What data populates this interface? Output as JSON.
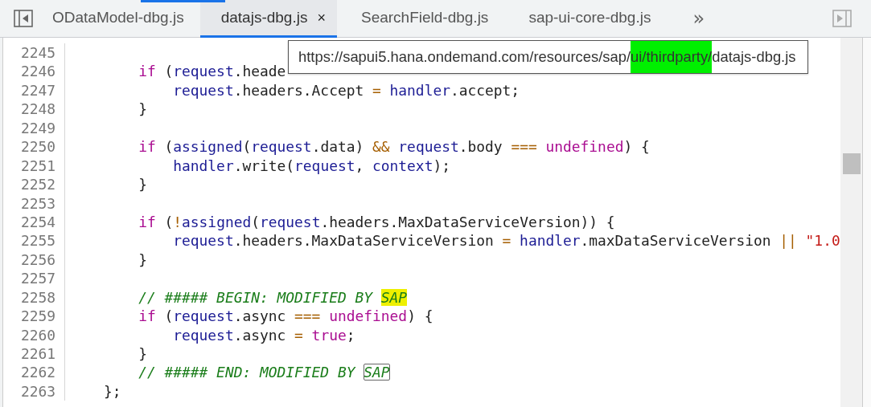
{
  "tabs": [
    {
      "label": "ODataModel-dbg.js",
      "selected": false
    },
    {
      "label": "datajs-dbg.js",
      "selected": true,
      "close": "×"
    },
    {
      "label": "SearchField-dbg.js",
      "selected": false
    },
    {
      "label": "sap-ui-core-dbg.js",
      "selected": false
    }
  ],
  "overflow": "»",
  "tooltip": {
    "parts": [
      {
        "text": "https://sapui5.hana.ondemand.com/resources/sap/",
        "highlighted": false
      },
      {
        "text": "ui/thirdparty/",
        "highlighted": true
      },
      {
        "text": "datajs-dbg.js",
        "highlighted": false
      }
    ]
  },
  "lines": [
    {
      "number": "2245"
    },
    {
      "number": "2246",
      "tokens": [
        {
          "kind": "keyword",
          "text": "        if"
        },
        {
          "kind": "plain",
          "text": " ("
        },
        {
          "kind": "variable",
          "text": "request"
        },
        {
          "kind": "plain",
          "text": ".heade"
        }
      ]
    },
    {
      "number": "2247",
      "tokens": [
        {
          "kind": "variable",
          "text": "            request"
        },
        {
          "kind": "plain",
          "text": ".headers.Accept "
        },
        {
          "kind": "operator",
          "text": "="
        },
        {
          "kind": "variable",
          "text": " handler"
        },
        {
          "kind": "plain",
          "text": ".accept;"
        }
      ]
    },
    {
      "number": "2248",
      "tokens": [
        {
          "kind": "plain",
          "text": "        }"
        }
      ]
    },
    {
      "number": "2249"
    },
    {
      "number": "2250",
      "tokens": [
        {
          "kind": "keyword",
          "text": "        if"
        },
        {
          "kind": "plain",
          "text": " ("
        },
        {
          "kind": "variable",
          "text": "assigned"
        },
        {
          "kind": "plain",
          "text": "("
        },
        {
          "kind": "variable",
          "text": "request"
        },
        {
          "kind": "plain",
          "text": ".data) "
        },
        {
          "kind": "operator",
          "text": "&&"
        },
        {
          "kind": "variable",
          "text": " request"
        },
        {
          "kind": "plain",
          "text": ".body "
        },
        {
          "kind": "operator",
          "text": "==="
        },
        {
          "kind": "keyword",
          "text": " undefined"
        },
        {
          "kind": "plain",
          "text": ") {"
        }
      ]
    },
    {
      "number": "2251",
      "tokens": [
        {
          "kind": "variable",
          "text": "            handler"
        },
        {
          "kind": "plain",
          "text": ".write("
        },
        {
          "kind": "variable",
          "text": "request"
        },
        {
          "kind": "plain",
          "text": ", "
        },
        {
          "kind": "variable",
          "text": "context"
        },
        {
          "kind": "plain",
          "text": ");"
        }
      ]
    },
    {
      "number": "2252",
      "tokens": [
        {
          "kind": "plain",
          "text": "        }"
        }
      ]
    },
    {
      "number": "2253"
    },
    {
      "number": "2254",
      "tokens": [
        {
          "kind": "keyword",
          "text": "        if"
        },
        {
          "kind": "plain",
          "text": " ("
        },
        {
          "kind": "operator",
          "text": "!"
        },
        {
          "kind": "variable",
          "text": "assigned"
        },
        {
          "kind": "plain",
          "text": "("
        },
        {
          "kind": "variable",
          "text": "request"
        },
        {
          "kind": "plain",
          "text": ".headers.MaxDataServiceVersion)) {"
        }
      ]
    },
    {
      "number": "2255",
      "tokens": [
        {
          "kind": "variable",
          "text": "            request"
        },
        {
          "kind": "plain",
          "text": ".headers.MaxDataServiceVersion "
        },
        {
          "kind": "operator",
          "text": "="
        },
        {
          "kind": "variable",
          "text": " handler"
        },
        {
          "kind": "plain",
          "text": ".maxDataServiceVersion "
        },
        {
          "kind": "operator",
          "text": "||"
        },
        {
          "kind": "string",
          "text": " \"1.0"
        }
      ]
    },
    {
      "number": "2256",
      "tokens": [
        {
          "kind": "plain",
          "text": "        }"
        }
      ]
    },
    {
      "number": "2257"
    },
    {
      "number": "2258",
      "tokens": [
        {
          "kind": "comment",
          "text": "        // ##### BEGIN: MODIFIED BY "
        },
        {
          "kind": "match",
          "text": "SAP"
        }
      ]
    },
    {
      "number": "2259",
      "tokens": [
        {
          "kind": "keyword",
          "text": "        if"
        },
        {
          "kind": "plain",
          "text": " ("
        },
        {
          "kind": "variable",
          "text": "request"
        },
        {
          "kind": "plain",
          "text": ".async "
        },
        {
          "kind": "operator",
          "text": "==="
        },
        {
          "kind": "keyword",
          "text": " undefined"
        },
        {
          "kind": "plain",
          "text": ") {"
        }
      ]
    },
    {
      "number": "2260",
      "tokens": [
        {
          "kind": "variable",
          "text": "            request"
        },
        {
          "kind": "plain",
          "text": ".async "
        },
        {
          "kind": "operator",
          "text": "="
        },
        {
          "kind": "keyword",
          "text": " true"
        },
        {
          "kind": "plain",
          "text": ";"
        }
      ]
    },
    {
      "number": "2261",
      "tokens": [
        {
          "kind": "plain",
          "text": "        }"
        }
      ]
    },
    {
      "number": "2262",
      "tokens": [
        {
          "kind": "comment",
          "text": "        // ##### END: MODIFIED BY "
        },
        {
          "kind": "current-match",
          "text": "SAP"
        }
      ]
    },
    {
      "number": "2263",
      "tokens": [
        {
          "kind": "plain",
          "text": "    };"
        }
      ]
    }
  ]
}
